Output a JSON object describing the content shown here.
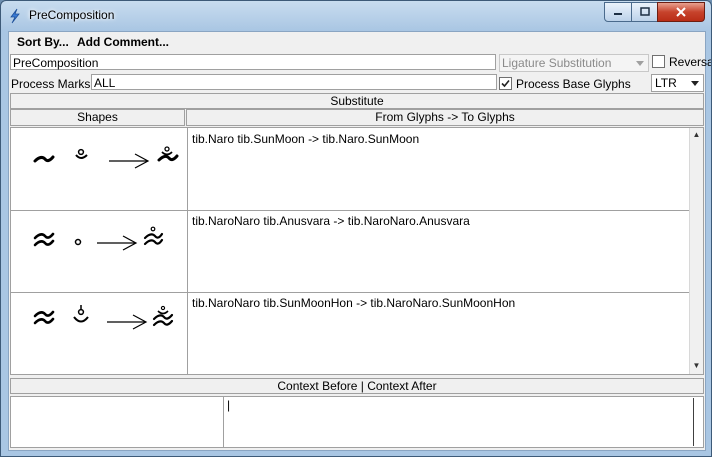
{
  "window": {
    "title": "PreComposition"
  },
  "menu": {
    "items": [
      "Sort By...",
      "Add Comment..."
    ]
  },
  "lookup": {
    "name": "PreComposition",
    "type": "Ligature Substitution",
    "reverse_label": "Reversal",
    "process_marks_label": "Process Marks:",
    "process_marks_value": "ALL",
    "process_base_label": "Process Base Glyphs",
    "direction": "LTR"
  },
  "sections": {
    "substitute": "Substitute",
    "shapes": "Shapes",
    "mapping": "From Glyphs -> To Glyphs",
    "context": "Context Before | Context After"
  },
  "rules": [
    {
      "text": "tib.Naro tib.SunMoon -> tib.Naro.SunMoon"
    },
    {
      "text": "tib.NaroNaro tib.Anusvara -> tib.NaroNaro.Anusvara"
    },
    {
      "text": "tib.NaroNaro tib.SunMoonHon -> tib.NaroNaro.SunMoonHon"
    }
  ],
  "context": {
    "before": "",
    "after": "|"
  },
  "icons": {
    "app": "lightning-icon",
    "minimize": "minimize-icon",
    "maximize": "maximize-icon",
    "close": "close-icon",
    "scroll_up": "scroll-up-arrow-icon",
    "scroll_down": "scroll-down-arrow-icon",
    "combo_arrow": "chevron-down-icon"
  },
  "colors": {
    "title_bar": "#a9c6e3",
    "close_button": "#c7432c"
  }
}
